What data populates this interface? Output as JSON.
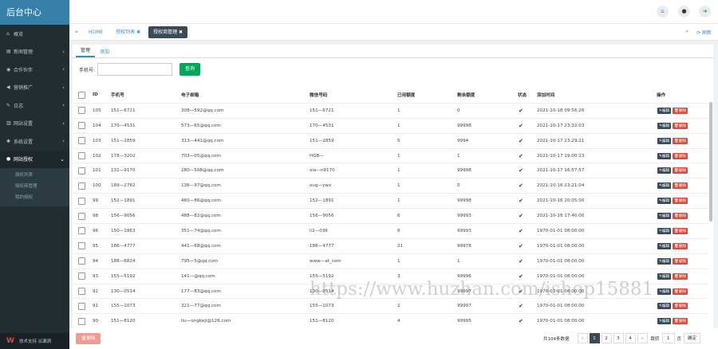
{
  "sidebar": {
    "brand": "后台中心",
    "items": [
      {
        "icon": "home-icon",
        "glyph": "⌂",
        "label": "概览",
        "arrow": ""
      },
      {
        "icon": "news-icon",
        "glyph": "▤",
        "label": "新闻管理",
        "arrow": "‹"
      },
      {
        "icon": "eye-icon",
        "glyph": "◉",
        "label": "合作伙伴",
        "arrow": "‹"
      },
      {
        "icon": "bullhorn-icon",
        "glyph": "◀",
        "label": "营销推广",
        "arrow": "‹"
      },
      {
        "icon": "edit-icon",
        "glyph": "✎",
        "label": "日志",
        "arrow": "‹"
      },
      {
        "icon": "chart-icon",
        "glyph": "▥",
        "label": "网站设置",
        "arrow": "‹"
      },
      {
        "icon": "gear-icon",
        "glyph": "✱",
        "label": "系统设置",
        "arrow": "‹"
      },
      {
        "icon": "user-icon",
        "glyph": "●",
        "label": "网站授权",
        "arrow": "⌄"
      }
    ],
    "submenu": [
      "授权列表",
      "授权商管理",
      "我的授权"
    ],
    "footer": "技术支持 派漏洞"
  },
  "tabs": {
    "home": "HOME",
    "t1": "授权列表 ✖",
    "t2": "授权商管理 ✖",
    "refresh": "⟳ 刷新"
  },
  "panel": {
    "tab_manage": "管理",
    "tab_add": "添加",
    "search_label": "手机号:",
    "search_btn": "查询"
  },
  "table": {
    "headers": [
      "ID",
      "手机号",
      "电子邮箱",
      "微信号码",
      "已用额度",
      "剩余额度",
      "状态",
      "添加时间",
      "操作"
    ],
    "edit_label": "✎编辑",
    "delete_label": "🗑删除",
    "rows": [
      [
        "105",
        "151—6721",
        "308—592@qq.com",
        "151—6721",
        "1",
        "0",
        "2021-10-18 09:56:26"
      ],
      [
        "104",
        "170—4531",
        "573—65@qq.com",
        "170—4531",
        "1",
        "99998",
        "2021-10-17 23:32:03"
      ],
      [
        "103",
        "151—2859",
        "313—441@qq.com",
        "151—2859",
        "5",
        "9994",
        "2021-10-17 23:29:21"
      ],
      [
        "102",
        "178—3202",
        "703—05@qq.com",
        "HGB—",
        "1",
        "1",
        "2021-10-17 19:00:13"
      ],
      [
        "101",
        "131—9170",
        "280—508@qq.com",
        "xia—n9170",
        "1",
        "99998",
        "2021-10-17 16:57:57"
      ],
      [
        "100",
        "189—2762",
        "136—97@qq.com",
        "xug—ywx",
        "1",
        "0",
        "2021-10-16 23:21:04"
      ],
      [
        "99",
        "152—1891",
        "460—86@qq.com",
        "152—1891",
        "1",
        "99998",
        "2021-10-16 20:05:00"
      ],
      [
        "98",
        "156—9056",
        "488—82@qq.com",
        "156—9056",
        "6",
        "99993",
        "2021-10-16 17:40:00"
      ],
      [
        "96",
        "150—1863",
        "351—74@qq.com",
        "li2—036",
        "6",
        "99993",
        "1970-01-01 08:00:00"
      ],
      [
        "95",
        "186—4777",
        "441—68@qq.com",
        "186—4777",
        "21",
        "99978",
        "1970-01-01 08:00:00"
      ],
      [
        "94",
        "188—6824",
        "795—5@qq.com",
        "www—at_com",
        "1",
        "1",
        "1970-01-01 08:00:00"
      ],
      [
        "93",
        "155—5192",
        "141—@qq.com",
        "155—5192",
        "3",
        "99996",
        "1970-01-01 08:00:00"
      ],
      [
        "92",
        "130—0514",
        "177—83@qq.com",
        "130—0514",
        "",
        "99997",
        "1970-01-01 08:00:00"
      ],
      [
        "91",
        "155—1073",
        "321—77@qq.com",
        "155—1073",
        "2",
        "99997",
        "1970-01-01 08:00:00"
      ],
      [
        "90",
        "151—8120",
        "liu—ongkeji@126.com",
        "151—8120",
        "4",
        "99995",
        "1970-01-01 08:00:00"
      ]
    ]
  },
  "footer": {
    "delete_btn": "🗑删除",
    "total": "共104条数据",
    "prev": "‹",
    "pages": [
      "1",
      "2",
      "3",
      "4"
    ],
    "next": "›",
    "goto_label": "跳转",
    "goto_value": "1",
    "page_unit": "页",
    "go_btn": "确定"
  },
  "watermark": "https://www.huzhan.com/ishop15881"
}
